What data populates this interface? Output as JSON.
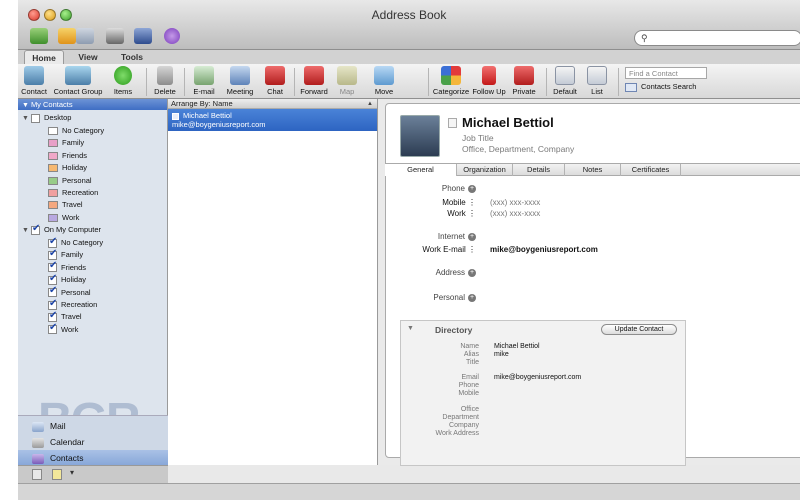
{
  "window": {
    "title": "Address Book"
  },
  "tabs": [
    "Home",
    "View",
    "Tools"
  ],
  "ribbon": {
    "contact": "Contact",
    "contact_group": "Contact Group",
    "items": "Items",
    "delete": "Delete",
    "email": "E-mail",
    "meeting": "Meeting",
    "chat": "Chat",
    "forward": "Forward",
    "map": "Map",
    "move": "Move",
    "categorize": "Categorize",
    "follow_up": "Follow Up",
    "private": "Private",
    "default": "Default",
    "list": "List",
    "find_placeholder": "Find a Contact",
    "contacts_search": "Contacts Search"
  },
  "sidebar": {
    "header": "My Contacts",
    "desktop": {
      "label": "Desktop",
      "checked": false,
      "items": [
        {
          "label": "No Category",
          "color": "#ffffff"
        },
        {
          "label": "Family",
          "color": "#e8a0c8"
        },
        {
          "label": "Friends",
          "color": "#f0a8c8"
        },
        {
          "label": "Holiday",
          "color": "#f6b870"
        },
        {
          "label": "Personal",
          "color": "#98cc88"
        },
        {
          "label": "Recreation",
          "color": "#f0a0a0"
        },
        {
          "label": "Travel",
          "color": "#f4a880"
        },
        {
          "label": "Work",
          "color": "#b8a8e0"
        }
      ]
    },
    "computer": {
      "label": "On My Computer",
      "checked": true,
      "items": [
        {
          "label": "No Category"
        },
        {
          "label": "Family"
        },
        {
          "label": "Friends"
        },
        {
          "label": "Holiday"
        },
        {
          "label": "Personal"
        },
        {
          "label": "Recreation"
        },
        {
          "label": "Travel"
        },
        {
          "label": "Work"
        }
      ]
    },
    "nav": [
      {
        "label": "Mail",
        "active": false
      },
      {
        "label": "Calendar",
        "active": false
      },
      {
        "label": "Contacts",
        "active": true
      }
    ],
    "watermark": "BGR"
  },
  "list": {
    "header": "Arrange By: Name",
    "contact": {
      "name": "Michael Bettiol",
      "email": "mike@boygeniusreport.com"
    }
  },
  "detail": {
    "name": "Michael Bettiol",
    "job_title": "Job Title",
    "office": "Office,  Department,  Company",
    "tabs": [
      "General",
      "Organization",
      "Details",
      "Notes",
      "Certificates"
    ],
    "phone_label": "Phone",
    "mobile_label": "Mobile",
    "mobile_value": "(xxx) xxx-xxxx",
    "work_label": "Work",
    "work_value": "(xxx) xxx-xxxx",
    "internet_label": "Internet",
    "work_email_label": "Work E-mail",
    "work_email_value": "mike@boygeniusreport.com",
    "address_label": "Address",
    "personal_label": "Personal",
    "directory": {
      "title": "Directory",
      "update_button": "Update Contact",
      "name_label": "Name",
      "name_value": "Michael Bettiol",
      "alias_label": "Alias",
      "alias_value": "mike",
      "title_label": "Title",
      "email_label": "Email",
      "email_value": "mike@boygeniusreport.com",
      "phone_label": "Phone",
      "mobile_label": "Mobile",
      "office_label": "Office",
      "department_label": "Department",
      "company_label": "Company",
      "work_address_label": "Work Address"
    }
  }
}
